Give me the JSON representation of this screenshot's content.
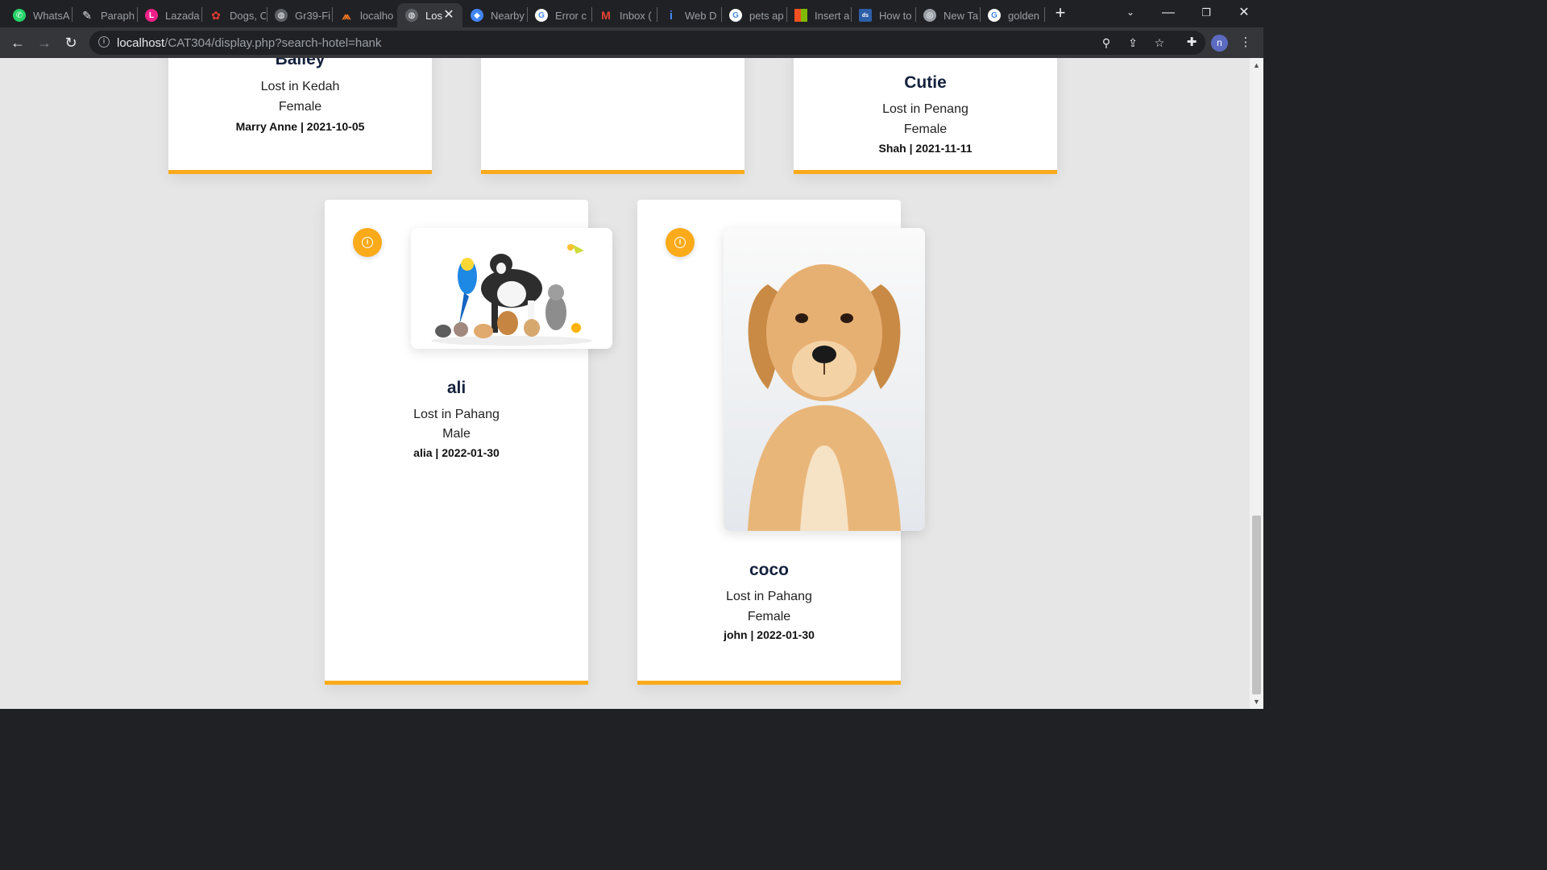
{
  "tabs": [
    {
      "label": "WhatsA",
      "icon": "whatsapp-icon",
      "color": "#25d366"
    },
    {
      "label": "Paraph",
      "icon": "quill-icon",
      "color": "#9aa0a6"
    },
    {
      "label": "Lazada",
      "icon": "lazada-icon",
      "color": "#f0208a"
    },
    {
      "label": "Dogs, C",
      "icon": "paw-icon",
      "color": "#e53935"
    },
    {
      "label": "Gr39-Fi",
      "icon": "globe-icon",
      "color": "#9aa0a6"
    },
    {
      "label": "localho",
      "icon": "xampp-icon",
      "color": "#fb7a24"
    },
    {
      "label": "Los",
      "icon": "globe-icon",
      "color": "#9aa0a6",
      "active": true
    },
    {
      "label": "Nearby",
      "icon": "maps-icon",
      "color": "#4285f4"
    },
    {
      "label": "Error c",
      "icon": "google-icon",
      "color": "#4285f4"
    },
    {
      "label": "Inbox (",
      "icon": "gmail-icon",
      "color": "#ea4335"
    },
    {
      "label": "Web D",
      "icon": "info-icon",
      "color": "#4285f4"
    },
    {
      "label": "pets ap",
      "icon": "google-icon",
      "color": "#4285f4"
    },
    {
      "label": "Insert a",
      "icon": "microsoft-icon",
      "color": "#f25022"
    },
    {
      "label": "How to",
      "icon": "site-icon",
      "color": "#2d5fa8"
    },
    {
      "label": "New Ta",
      "icon": "chrome-icon",
      "color": "#9aa0a6"
    },
    {
      "label": "golden",
      "icon": "google-icon",
      "color": "#4285f4"
    }
  ],
  "url": {
    "host": "localhost",
    "path": "/CAT304/display.php?search-hotel=hank"
  },
  "profile_initial": "n",
  "cards": [
    {
      "name": "Bailey",
      "lost": "Lost in Kedah",
      "gender": "Female",
      "meta": "Marry Anne | 2021-10-05"
    },
    {
      "name": "",
      "lost": "",
      "gender": "",
      "meta": ""
    },
    {
      "name": "Cutie",
      "lost": "Lost in Penang",
      "gender": "Female",
      "meta": "Shah | 2021-11-11"
    },
    {
      "name": "ali",
      "lost": "Lost in Pahang",
      "gender": "Male",
      "meta": "alia | 2022-01-30"
    },
    {
      "name": "coco",
      "lost": "Lost in Pahang",
      "gender": "Female",
      "meta": "john | 2022-01-30"
    }
  ],
  "colors": {
    "accent": "#fbaa1a",
    "page_bg": "#e6e6e6",
    "name_text": "#14213d"
  }
}
